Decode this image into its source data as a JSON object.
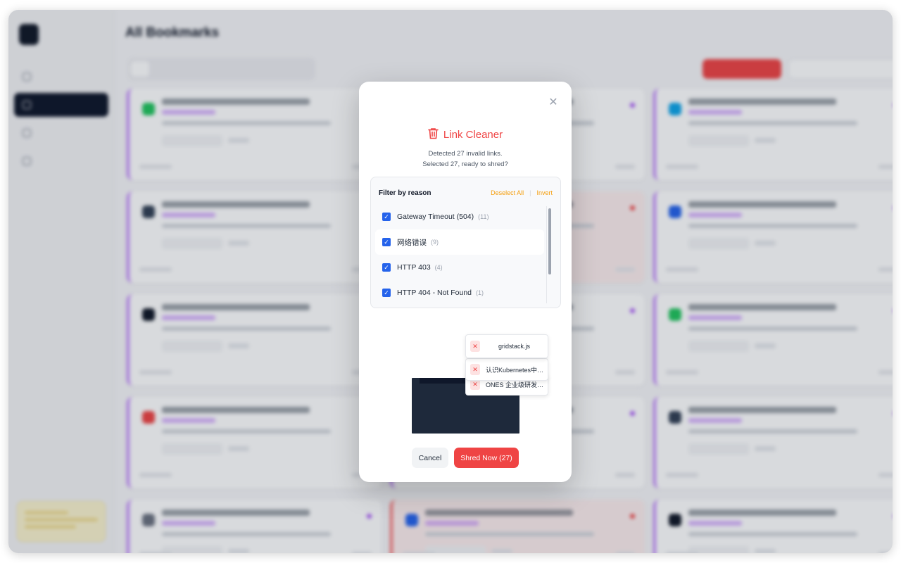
{
  "colors": {
    "accent_red": "#ef4444",
    "link_orange": "#f59e0b",
    "checkbox_blue": "#2563eb",
    "card_purple": "#c084fc",
    "shredder_dark": "#1e293b"
  },
  "background": {
    "nav_items": [
      {
        "icon": "dashboard-icon"
      },
      {
        "icon": "bookmark-icon",
        "active": true
      },
      {
        "icon": "ai-organizer-icon"
      },
      {
        "icon": "settings-icon"
      }
    ],
    "page_title": "All Bookmarks"
  },
  "modal": {
    "title_icon": "trash-icon",
    "title": "Link Cleaner",
    "subtitle_line1": "Detected 27 invalid links.",
    "subtitle_line2": "Selected 27, ready to shred?",
    "filter": {
      "heading": "Filter by reason",
      "deselect_all": "Deselect All",
      "separator": "|",
      "invert": "Invert",
      "reasons": [
        {
          "label": "Gateway Timeout (504)",
          "count": "(11)",
          "checked": true
        },
        {
          "label": "网络错误",
          "count": "(9)",
          "checked": true
        },
        {
          "label": "HTTP 403",
          "count": "(4)",
          "checked": true
        },
        {
          "label": "HTTP 404 - Not Found",
          "count": "(1)",
          "checked": true
        }
      ]
    },
    "shred_items": [
      {
        "title": "gridstack.js"
      },
      {
        "title": "认识Kubernetes中的..."
      },
      {
        "title": "ONES 企业级研发管..."
      }
    ],
    "cancel_label": "Cancel",
    "shred_label": "Shred Now (27)"
  }
}
